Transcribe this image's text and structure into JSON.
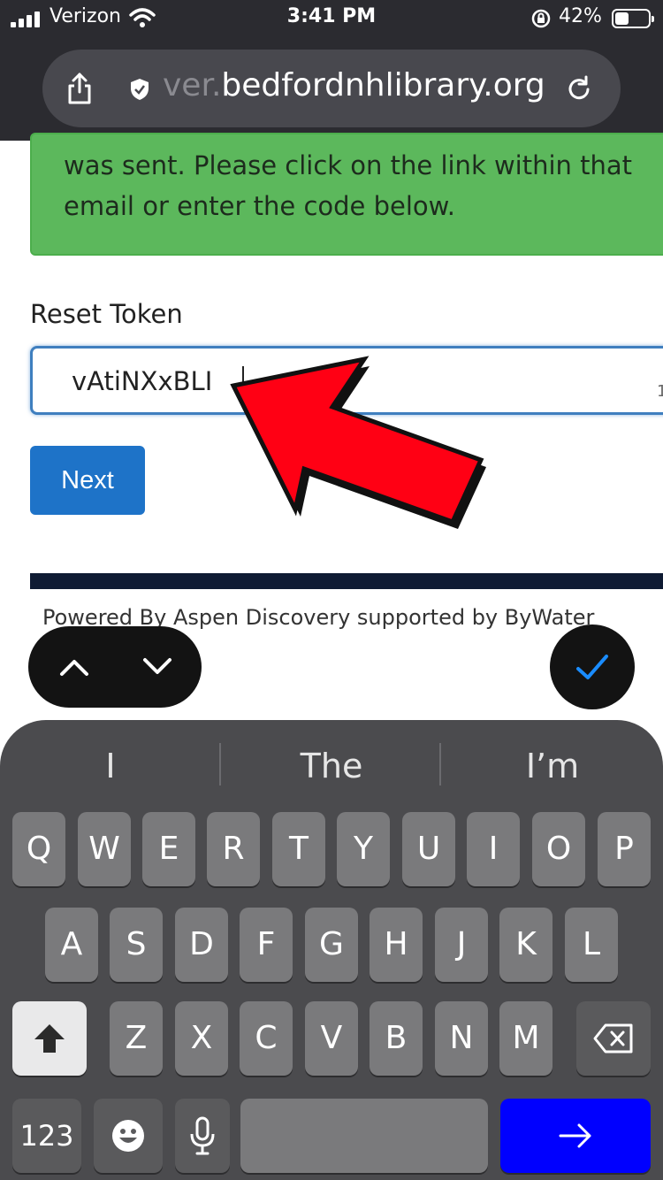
{
  "status_bar": {
    "carrier": "Verizon",
    "time": "3:41 PM",
    "battery_percent": "42%",
    "battery_level": 0.42
  },
  "browser": {
    "url_faded": "ver.",
    "url_main": "bedfordnhlibrary.org"
  },
  "page": {
    "alert_text": "was sent. Please click on the link within that email or enter the code below.",
    "reset_token_label": "Reset Token",
    "reset_token_value": "vAtiNXxBLI",
    "next_label": "Next",
    "footer_text": "Powered By Aspen Discovery supported by ByWater"
  },
  "keyboard": {
    "suggestions": [
      "I",
      "The",
      "I’m"
    ],
    "row1": [
      "Q",
      "W",
      "E",
      "R",
      "T",
      "Y",
      "U",
      "I",
      "O",
      "P"
    ],
    "row2": [
      "A",
      "S",
      "D",
      "F",
      "G",
      "H",
      "J",
      "K",
      "L"
    ],
    "row3": [
      "Z",
      "X",
      "C",
      "V",
      "B",
      "N",
      "M"
    ],
    "numbers_label": "123",
    "colors": {
      "go_key": "#0000ff",
      "done_check": "#1a8cff"
    }
  },
  "icons": {
    "share": "share-icon",
    "secure": "shield-icon",
    "reload": "reload-icon",
    "prev": "chevron-up-icon",
    "next": "chevron-down-icon",
    "done": "checkmark-icon",
    "shift": "shift-icon",
    "delete": "backspace-icon",
    "emoji": "emoji-icon",
    "mic": "microphone-icon",
    "go": "arrow-right-icon"
  }
}
